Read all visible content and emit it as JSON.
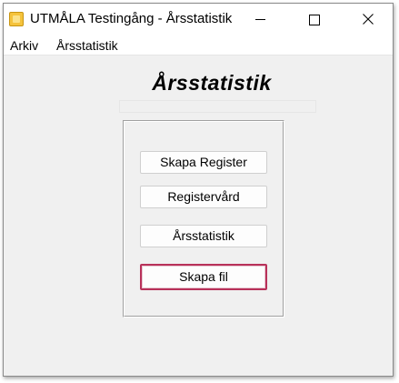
{
  "window": {
    "title": "UTMÅLA Testingång - Årsstatistik",
    "controls": {
      "minimize": "minimize",
      "maximize": "maximize",
      "close": "close"
    }
  },
  "menu": {
    "items": [
      {
        "label": "Arkiv"
      },
      {
        "label": "Årsstatistik"
      }
    ]
  },
  "main": {
    "heading": "Årsstatistik",
    "buttons": [
      {
        "label": "Skapa Register"
      },
      {
        "label": "Registervård"
      },
      {
        "label": "Årsstatistik"
      },
      {
        "label": "Skapa fil",
        "focused": true
      }
    ]
  },
  "colors": {
    "focus_border": "#b8315a",
    "window_bg": "#f0f0f0",
    "app_icon": "#f5c33c"
  }
}
